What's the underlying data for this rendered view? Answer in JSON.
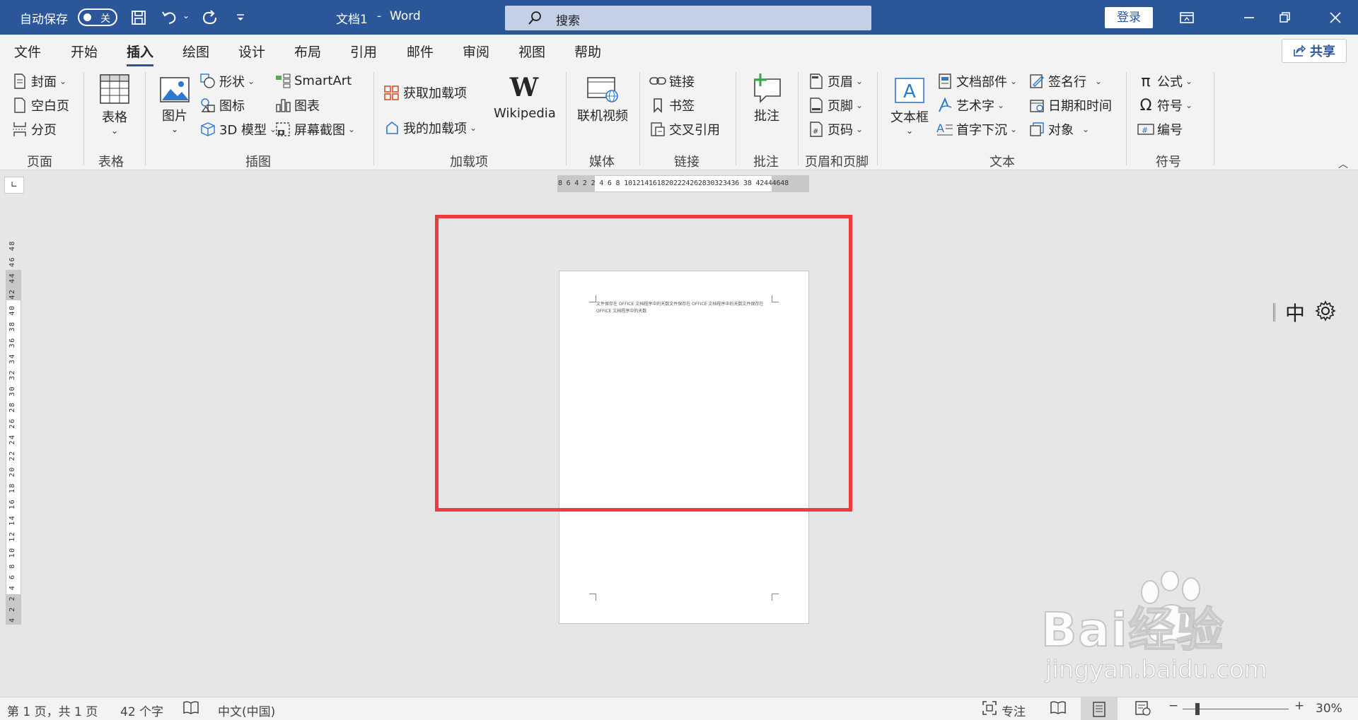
{
  "titlebar": {
    "autosave_label": "自动保存",
    "autosave_state": "关",
    "doc_title": "文档1",
    "separator": "-",
    "app_name": "Word",
    "search_placeholder": "搜索",
    "login_label": "登录"
  },
  "tabs": [
    "文件",
    "开始",
    "插入",
    "绘图",
    "设计",
    "布局",
    "引用",
    "邮件",
    "审阅",
    "视图",
    "帮助"
  ],
  "active_tab": "插入",
  "share_label": "共享",
  "ribbon": {
    "page": {
      "cover": "封面",
      "blank": "空白页",
      "break": "分页",
      "group": "页面"
    },
    "table": {
      "table": "表格",
      "group": "表格"
    },
    "illustrations": {
      "picture": "图片",
      "shapes": "形状",
      "icons": "图标",
      "model3d": "3D 模型",
      "smartart": "SmartArt",
      "chart": "图表",
      "screenshot": "屏幕截图",
      "group": "插图"
    },
    "addins": {
      "get": "获取加载项",
      "my": "我的加载项",
      "wikipedia": "Wikipedia",
      "group": "加载项"
    },
    "media": {
      "video": "联机视频",
      "group": "媒体"
    },
    "links": {
      "link": "链接",
      "bookmark": "书签",
      "crossref": "交叉引用",
      "group": "链接"
    },
    "comments": {
      "comment": "批注",
      "group": "批注"
    },
    "headerfooter": {
      "header": "页眉",
      "footer": "页脚",
      "pagenum": "页码",
      "group": "页眉和页脚"
    },
    "text": {
      "textbox": "文本框",
      "quickparts": "文档部件",
      "wordart": "艺术字",
      "dropcap": "首字下沉",
      "signature": "签名行",
      "datetime": "日期和时间",
      "object": "对象",
      "group": "文本"
    },
    "symbols": {
      "equation": "公式",
      "symbol": "符号",
      "number": "编号",
      "group": "符号"
    }
  },
  "rulers": {
    "horizontal": "8 6 4 2   2 4 6 8 1012141618202224262830323436 38   42444648",
    "vertical": "4 2   2 4 6 8 10 12 14 16 18 20 22 24 26 28 30 32 34 36 38 40 42 44 46 48"
  },
  "document": {
    "text": "文件保存在 OFFICE 文档程序中的天数文件保存在 OFFICE 文档程序中的天数文件保存在 OFFICE 文档程序中的天数"
  },
  "ime": {
    "mode": "中"
  },
  "watermark": {
    "brand": "Bai经验",
    "url": "jingyan.baidu.com"
  },
  "statusbar": {
    "page_info": "第 1 页，共 1 页",
    "word_count": "42 个字",
    "language": "中文(中国)",
    "focus": "专注",
    "zoom_minus": "−",
    "zoom_plus": "+",
    "zoom": "30%"
  },
  "colors": {
    "accent": "#2b579a",
    "highlight": "#ef3b3f"
  }
}
